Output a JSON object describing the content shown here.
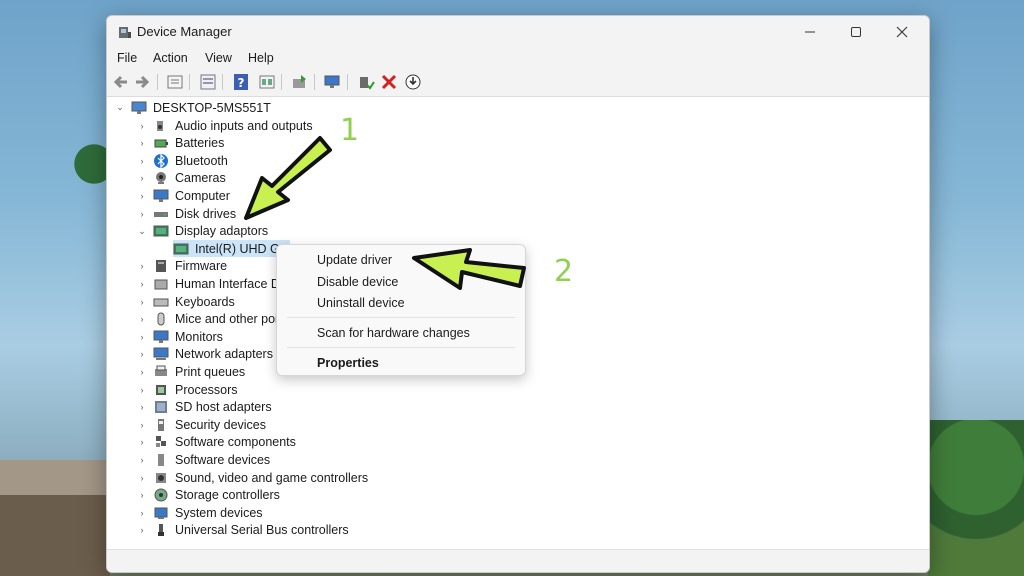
{
  "window": {
    "title": "Device Manager"
  },
  "menu": [
    "File",
    "Action",
    "View",
    "Help"
  ],
  "toolbar_icons": [
    "back-icon",
    "forward-icon",
    "properties-icon",
    "view-icon",
    "help-icon",
    "resources-icon",
    "update-icon",
    "monitor-icon",
    "enable-icon",
    "uninstall-icon",
    "download-icon"
  ],
  "tree": {
    "root": "DESKTOP-5MS551T",
    "items": [
      {
        "label": "Audio inputs and outputs",
        "icon": "speaker-icon"
      },
      {
        "label": "Batteries",
        "icon": "battery-icon"
      },
      {
        "label": "Bluetooth",
        "icon": "bluetooth-icon"
      },
      {
        "label": "Cameras",
        "icon": "camera-icon"
      },
      {
        "label": "Computer",
        "icon": "computer-icon"
      },
      {
        "label": "Disk drives",
        "icon": "disk-icon"
      },
      {
        "label": "Display adaptors",
        "icon": "display-adapter-icon",
        "expanded": true
      },
      {
        "label": "Firmware",
        "icon": "firmware-icon"
      },
      {
        "label": "Human Interface D",
        "icon": "hid-icon"
      },
      {
        "label": "Keyboards",
        "icon": "keyboard-icon"
      },
      {
        "label": "Mice and other poi",
        "icon": "mouse-icon"
      },
      {
        "label": "Monitors",
        "icon": "monitor-icon"
      },
      {
        "label": "Network adapters",
        "icon": "network-icon"
      },
      {
        "label": "Print queues",
        "icon": "printer-icon"
      },
      {
        "label": "Processors",
        "icon": "processor-icon"
      },
      {
        "label": "SD host adapters",
        "icon": "sd-icon"
      },
      {
        "label": "Security devices",
        "icon": "security-icon"
      },
      {
        "label": "Software components",
        "icon": "software-component-icon"
      },
      {
        "label": "Software devices",
        "icon": "software-device-icon"
      },
      {
        "label": "Sound, video and game controllers",
        "icon": "sound-icon"
      },
      {
        "label": "Storage controllers",
        "icon": "storage-icon"
      },
      {
        "label": "System devices",
        "icon": "system-icon"
      },
      {
        "label": "Universal Serial Bus controllers",
        "icon": "usb-icon"
      }
    ],
    "child": "Intel(R) UHD Gr"
  },
  "context_menu": {
    "update": "Update driver",
    "disable": "Disable device",
    "uninstall": "Uninstall device",
    "scan": "Scan for hardware changes",
    "properties": "Properties"
  },
  "annotations": {
    "step1": "1",
    "step2": "2"
  },
  "colors": {
    "accent": "#8fd14f",
    "arrow": "#c8f050"
  }
}
